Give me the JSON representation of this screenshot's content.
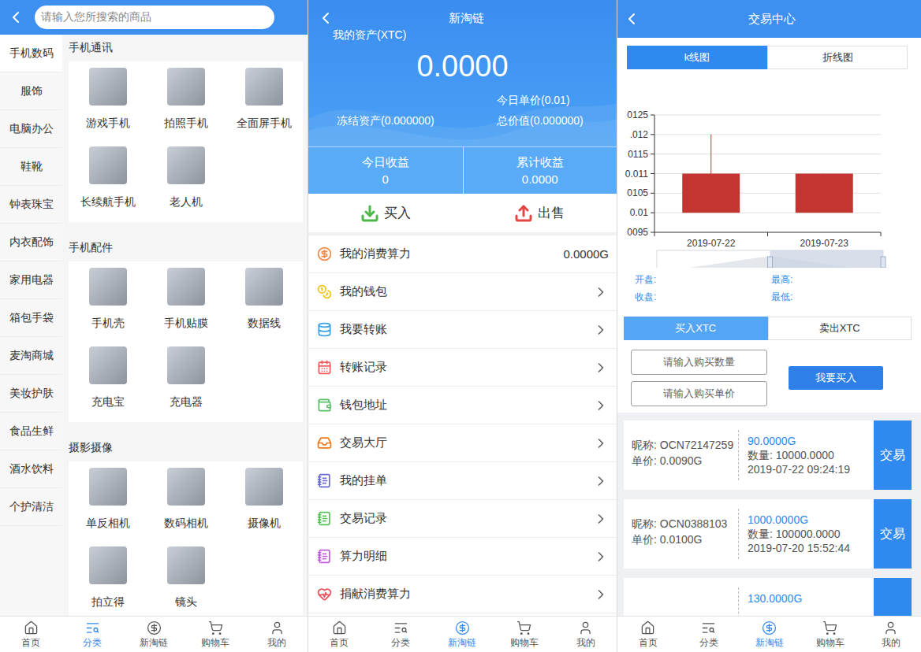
{
  "category_page": {
    "search": {
      "placeholder": "请输入您所搜索的商品"
    },
    "sidebar": {
      "items": [
        {
          "label": "手机数码",
          "selected": true
        },
        {
          "label": "服饰",
          "selected": false
        },
        {
          "label": "电脑办公",
          "selected": false
        },
        {
          "label": "鞋靴",
          "selected": false
        },
        {
          "label": "钟表珠宝",
          "selected": false
        },
        {
          "label": "内衣配饰",
          "selected": false
        },
        {
          "label": "家用电器",
          "selected": false
        },
        {
          "label": "箱包手袋",
          "selected": false
        },
        {
          "label": "麦淘商城",
          "selected": false
        },
        {
          "label": "美妆护肤",
          "selected": false
        },
        {
          "label": "食品生鲜",
          "selected": false
        },
        {
          "label": "酒水饮料",
          "selected": false
        },
        {
          "label": "个护清洁",
          "selected": false
        }
      ]
    },
    "sections": [
      {
        "title": "手机通讯",
        "items": [
          "游戏手机",
          "拍照手机",
          "全面屏手机",
          "长续航手机",
          "老人机"
        ]
      },
      {
        "title": "手机配件",
        "items": [
          "手机壳",
          "手机贴膜",
          "数据线",
          "充电宝",
          "充电器"
        ]
      },
      {
        "title": "摄影摄像",
        "items": [
          "单反相机",
          "数码相机",
          "摄像机",
          "拍立得",
          "镜头"
        ]
      }
    ],
    "tab_bar": [
      {
        "label": "首页",
        "selected": false
      },
      {
        "label": "分类",
        "selected": true
      },
      {
        "label": "新淘链",
        "selected": false
      },
      {
        "label": "购物车",
        "selected": false
      },
      {
        "label": "我的",
        "selected": false
      }
    ]
  },
  "wallet_page": {
    "title": "新淘链",
    "asset_label": "我的资产(XTC)",
    "asset_value": "0.0000",
    "today_price": "今日单价(0.01)",
    "frozen": "冻结资产(0.000000)",
    "total_value": "总价值(0.000000)",
    "earnings": [
      {
        "label": "今日收益",
        "value": "0"
      },
      {
        "label": "累计收益",
        "value": "0.0000"
      }
    ],
    "actions": [
      "买入",
      "出售"
    ],
    "menu": [
      {
        "label": "我的消费算力",
        "kind": "value",
        "value": "0.0000G"
      },
      {
        "label": "我的钱包",
        "kind": "link"
      },
      {
        "label": "我要转账",
        "kind": "link"
      },
      {
        "label": "转账记录",
        "kind": "link"
      },
      {
        "label": "钱包地址",
        "kind": "link"
      },
      {
        "label": "交易大厅",
        "kind": "link"
      },
      {
        "label": "我的挂单",
        "kind": "link"
      },
      {
        "label": "交易记录",
        "kind": "link"
      },
      {
        "label": "算力明细",
        "kind": "link"
      },
      {
        "label": "捐献消费算力",
        "kind": "link"
      }
    ],
    "tab_bar": [
      {
        "label": "首页",
        "selected": false
      },
      {
        "label": "分类",
        "selected": false
      },
      {
        "label": "新淘链",
        "selected": true
      },
      {
        "label": "购物车",
        "selected": false
      },
      {
        "label": "我的",
        "selected": false
      }
    ]
  },
  "trade_page": {
    "title": "交易中心",
    "chart_tabs": [
      {
        "label": "k线图",
        "selected": true
      },
      {
        "label": "折线图",
        "selected": false
      }
    ],
    "chart": {
      "y_axis": {
        "min": 0.0095,
        "max": 0.0125,
        "ticks": [
          "0125",
          ".012",
          "0115",
          "0.011",
          "0105",
          "0.01",
          "0095"
        ]
      },
      "x_axis": {
        "labels": [
          "2019-07-22",
          "2019-07-23"
        ]
      },
      "series": [
        {
          "name": "K",
          "open": [
            0.01,
            0.01
          ],
          "close": [
            0.011,
            0.011
          ],
          "high": [
            0.012,
            0.011
          ],
          "low": [
            0.01,
            0.01
          ]
        }
      ],
      "zoom": {
        "start": 0.5,
        "end": 1
      }
    },
    "stats": [
      "开盘:",
      "最高:",
      "收盘:",
      "最低:"
    ],
    "trade_tabs": [
      {
        "label": "买入XTC",
        "selected": true
      },
      {
        "label": "卖出XTC",
        "selected": false
      }
    ],
    "inputs": [
      {
        "placeholder": "请输入购买数量"
      },
      {
        "placeholder": "请输入购买单价"
      }
    ],
    "submit": "我要买入",
    "orders": [
      {
        "nickname": "昵称: OCN72147259",
        "price": "单价: 0.0090G",
        "amount": "90.0000G",
        "quantity": "数量: 10000.0000",
        "time": "2019-07-22 09:24:19",
        "action": "交易"
      },
      {
        "nickname": "昵称: OCN0388103",
        "price": "单价: 0.0100G",
        "amount": "1000.0000G",
        "quantity": "数量: 100000.0000",
        "time": "2019-07-20 15:52:44",
        "action": "交易"
      },
      {
        "amount": "130.0000G"
      }
    ],
    "tab_bar": [
      {
        "label": "首页",
        "selected": false
      },
      {
        "label": "分类",
        "selected": false
      },
      {
        "label": "新淘链",
        "selected": true
      },
      {
        "label": "购物车",
        "selected": false
      },
      {
        "label": "我的",
        "selected": false
      }
    ]
  }
}
